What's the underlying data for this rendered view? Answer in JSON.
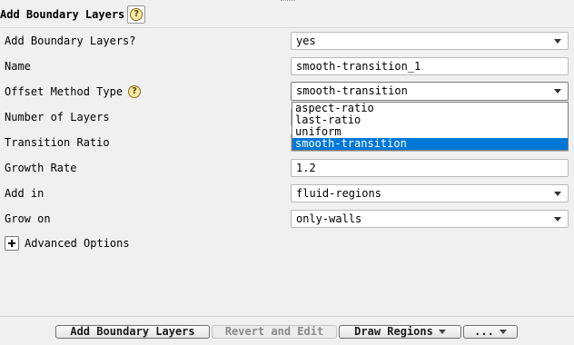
{
  "panel": {
    "title": "Add Boundary Layers",
    "help_icon": "question-circle-icon"
  },
  "rows": {
    "add_bl": {
      "label": "Add Boundary Layers?",
      "value": "yes"
    },
    "name": {
      "label": "Name",
      "value": "smooth-transition_1"
    },
    "offset_method": {
      "label": "Offset Method Type",
      "value": "smooth-transition",
      "options": [
        "aspect-ratio",
        "last-ratio",
        "uniform",
        "smooth-transition"
      ],
      "selected_option": "smooth-transition"
    },
    "num_layers": {
      "label": "Number of Layers"
    },
    "transition_ratio": {
      "label": "Transition Ratio"
    },
    "growth_rate": {
      "label": "Growth Rate",
      "value": "1.2"
    },
    "add_in": {
      "label": "Add in",
      "value": "fluid-regions"
    },
    "grow_on": {
      "label": "Grow on",
      "value": "only-walls"
    }
  },
  "advanced": {
    "label": "Advanced Options"
  },
  "buttons": {
    "add": "Add Boundary Layers",
    "revert": "Revert and Edit",
    "draw": "Draw Regions",
    "more": "..."
  },
  "colors": {
    "selection": "#0078d7",
    "background": "#f0f0f0"
  }
}
